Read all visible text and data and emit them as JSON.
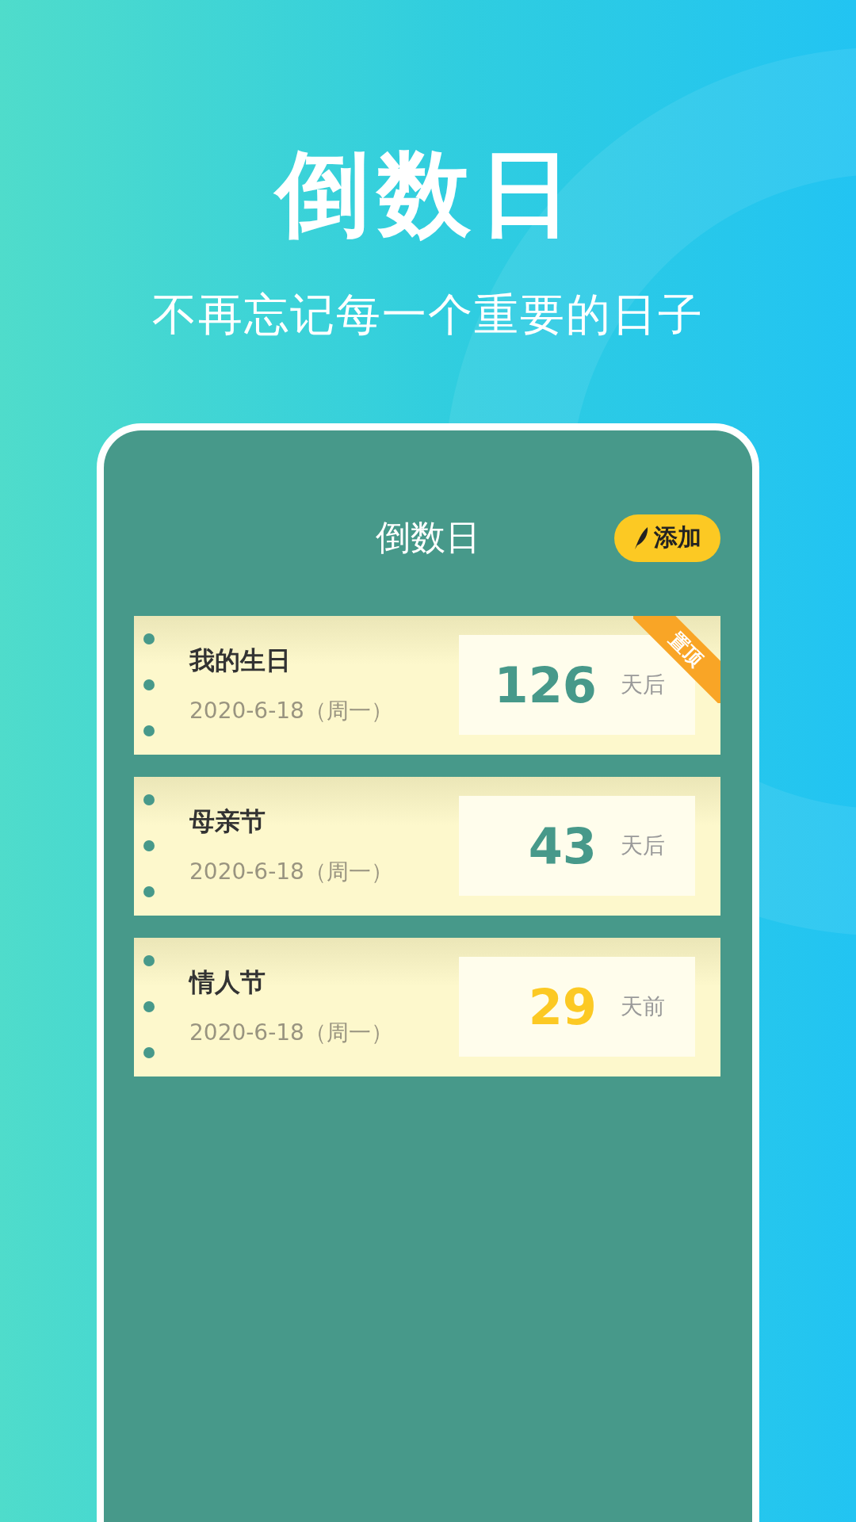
{
  "headline": "倒数日",
  "tagline": "不再忘记每一个重要的日子",
  "app": {
    "title": "倒数日",
    "add_button": "添加",
    "pinned_label": "置顶",
    "events": [
      {
        "name": "我的生日",
        "date": "2020-6-18（周一）",
        "count": "126",
        "suffix": "天后",
        "color": "#47998a",
        "pinned": true
      },
      {
        "name": "母亲节",
        "date": "2020-6-18（周一）",
        "count": "43",
        "suffix": "天后",
        "color": "#47998a",
        "pinned": false
      },
      {
        "name": "情人节",
        "date": "2020-6-18（周一）",
        "count": "29",
        "suffix": "天前",
        "color": "#fcc923",
        "pinned": false
      }
    ]
  }
}
